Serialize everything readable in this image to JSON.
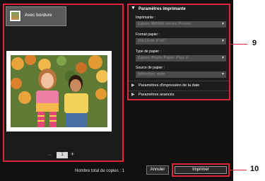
{
  "layout": {
    "label": "Avec bordure"
  },
  "pager": {
    "minus": "−",
    "page": "1",
    "plus": "+"
  },
  "settings": {
    "header": "Paramètres imprimante",
    "printer_label": "Imprimante :",
    "printer_value": "Canon MX000 series Printer",
    "paper_size_label": "Format papier :",
    "paper_size_value": "10x15cm 4\"x6\"",
    "media_type_label": "Type de papier :",
    "media_type_value": "Canon Photo Paper Plus II",
    "paper_source_label": "Source de papier :",
    "paper_source_value": "Sélection auto",
    "date_section": "Paramètres d'impression de la date",
    "advanced_section": "Paramètres avancés"
  },
  "footer": {
    "copies_text": "Nombre total de copies : 1",
    "cancel_label": "Annuler",
    "print_label": "Imprimer"
  },
  "callouts": {
    "settings_number": "9",
    "print_number": "10"
  },
  "colors": {
    "highlight": "#e0243a",
    "background": "#101010",
    "select": "#4a4a4a"
  }
}
